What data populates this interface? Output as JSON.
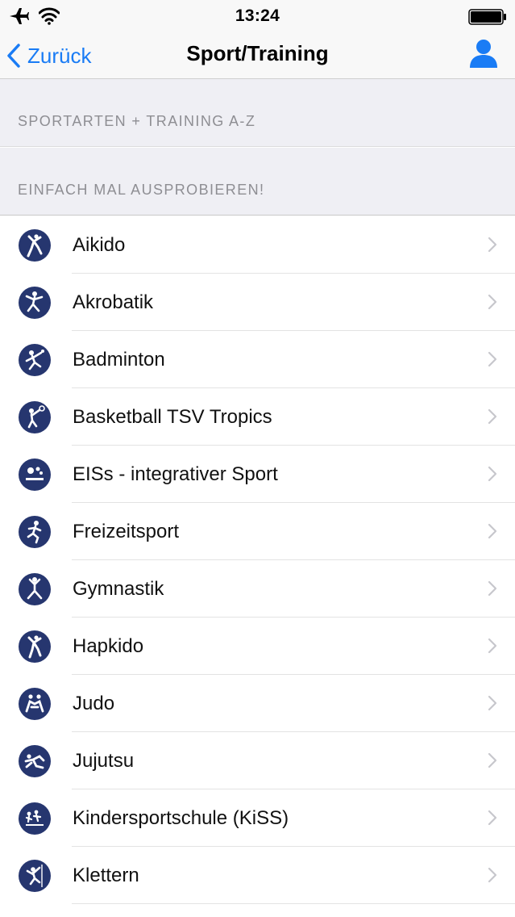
{
  "status_bar": {
    "time": "13:24"
  },
  "nav": {
    "back_label": "Zurück",
    "title": "Sport/Training"
  },
  "sections": {
    "a_header": "SPORTARTEN + TRAINING A-Z",
    "b_header": "EINFACH MAL AUSPROBIEREN!"
  },
  "items": [
    {
      "label": "Aikido",
      "icon": "aikido-icon"
    },
    {
      "label": "Akrobatik",
      "icon": "akrobatik-icon"
    },
    {
      "label": "Badminton",
      "icon": "badminton-icon"
    },
    {
      "label": "Basketball TSV Tropics",
      "icon": "basketball-icon"
    },
    {
      "label": "EISs - integrativer Sport",
      "icon": "integrativer-sport-icon"
    },
    {
      "label": "Freizeitsport",
      "icon": "freizeitsport-icon"
    },
    {
      "label": "Gymnastik",
      "icon": "gymnastik-icon"
    },
    {
      "label": "Hapkido",
      "icon": "hapkido-icon"
    },
    {
      "label": "Judo",
      "icon": "judo-icon"
    },
    {
      "label": "Jujutsu",
      "icon": "jujutsu-icon"
    },
    {
      "label": "Kindersportschule (KiSS)",
      "icon": "kiss-icon"
    },
    {
      "label": "Klettern",
      "icon": "klettern-icon"
    }
  ],
  "colors": {
    "accent": "#1a7cf5",
    "icon_background": "#26366f",
    "section_background": "#efeff4",
    "section_text": "#8e8e93"
  }
}
